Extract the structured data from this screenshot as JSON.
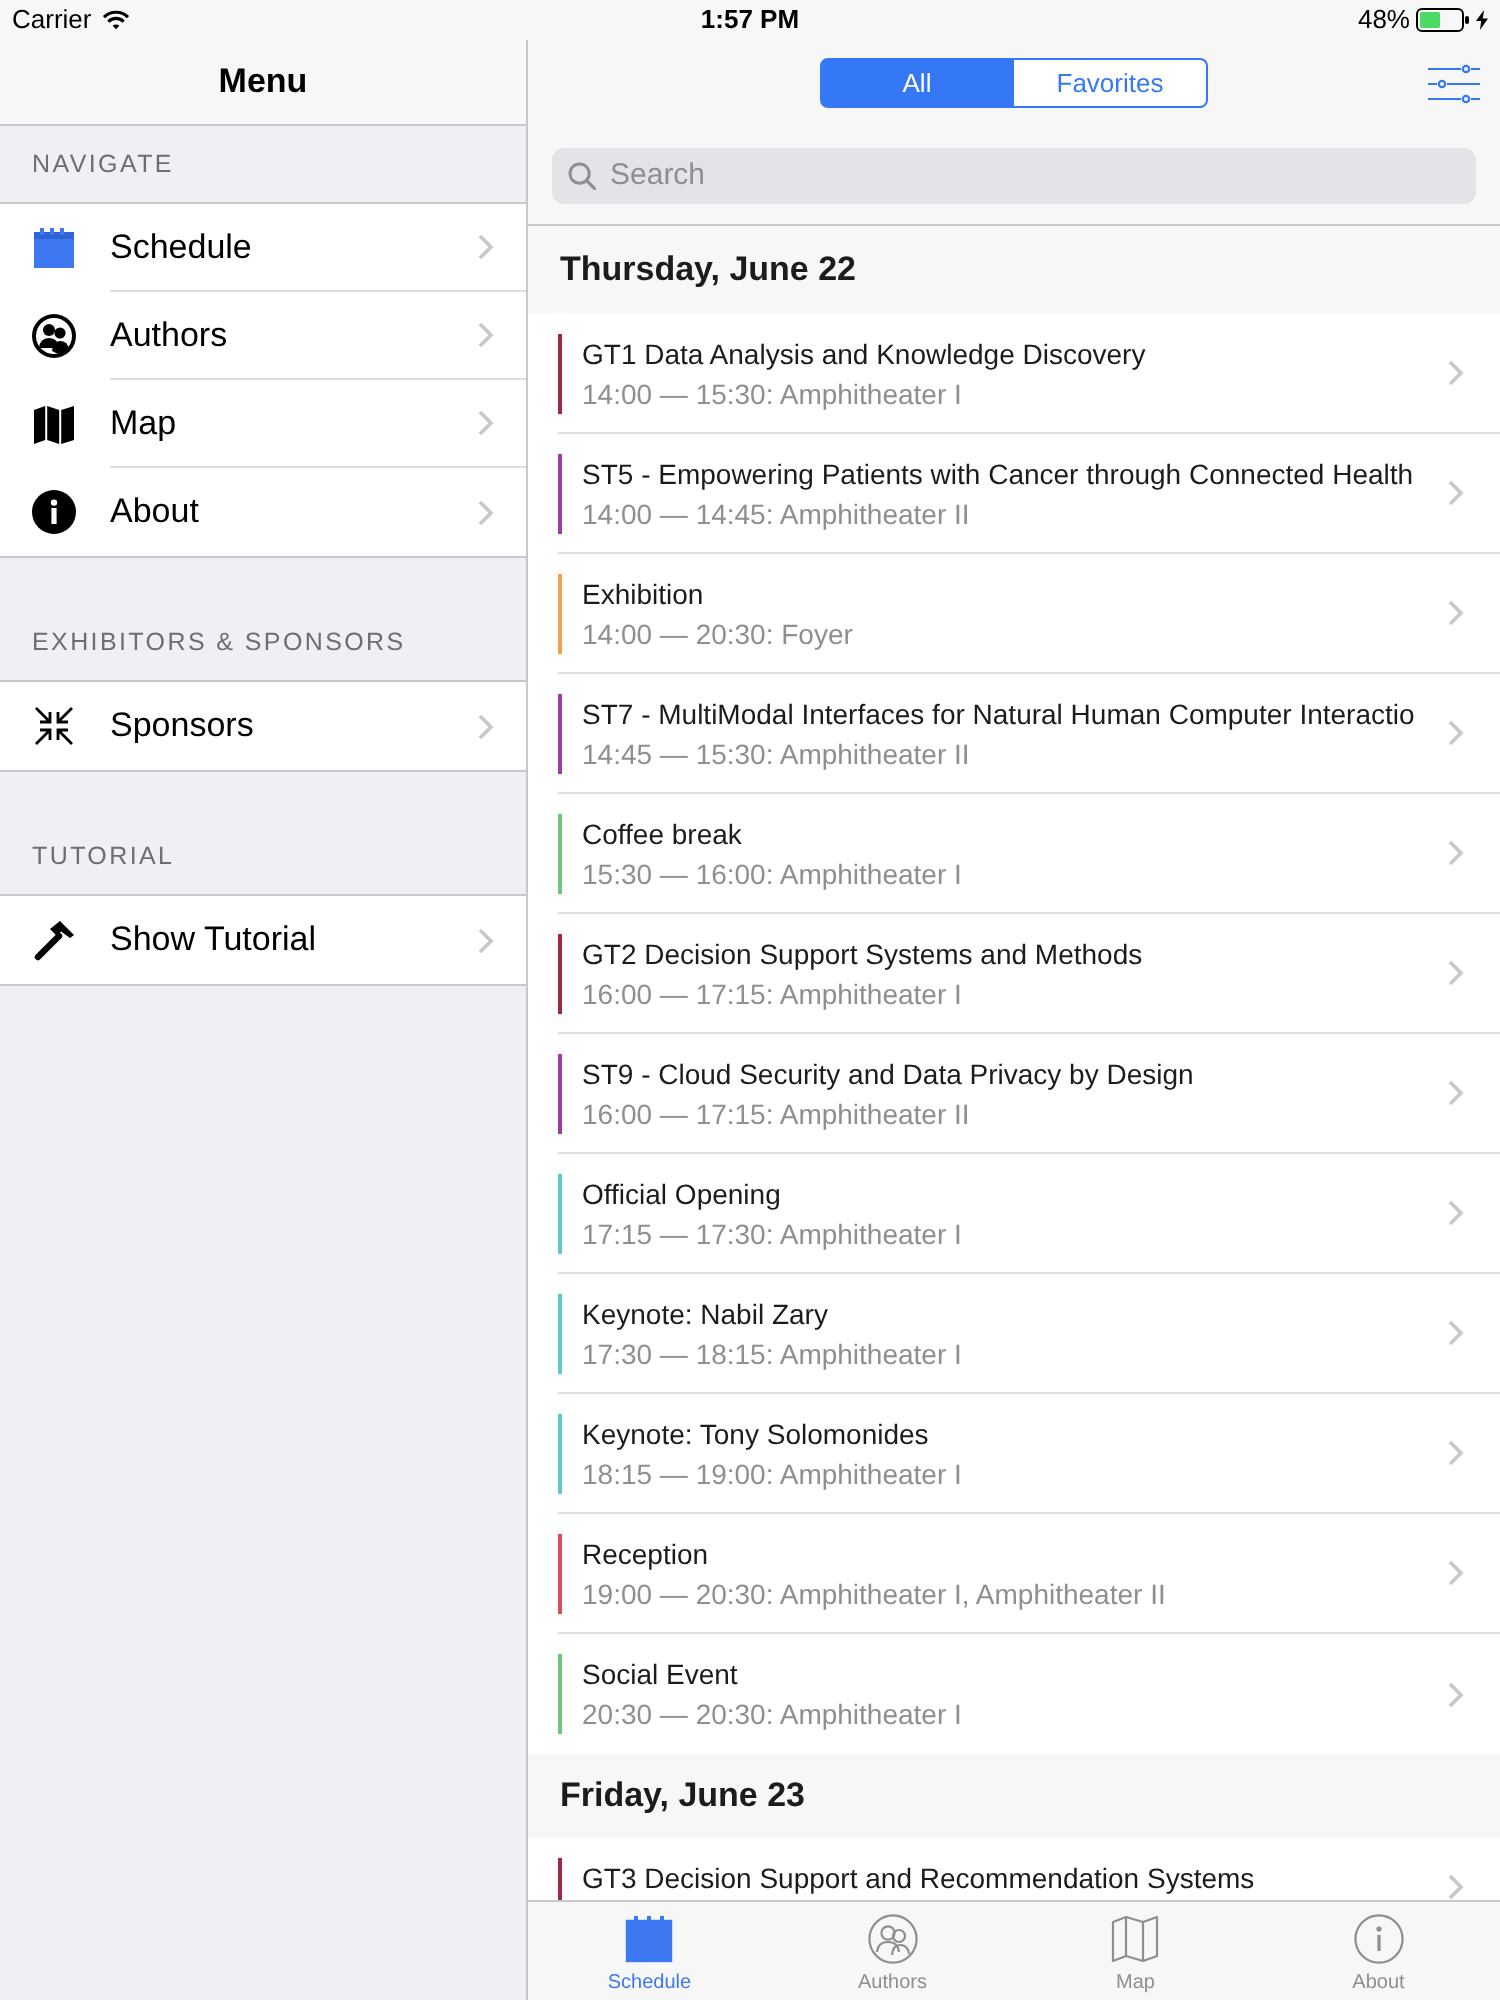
{
  "status_bar": {
    "carrier": "Carrier",
    "time": "1:57 PM",
    "battery": "48%"
  },
  "menu": {
    "title": "Menu",
    "sections": [
      {
        "header": "NAVIGATE",
        "items": [
          {
            "label": "Schedule"
          },
          {
            "label": "Authors"
          },
          {
            "label": "Map"
          },
          {
            "label": "About"
          }
        ]
      },
      {
        "header": "EXHIBITORS & SPONSORS",
        "items": [
          {
            "label": "Sponsors"
          }
        ]
      },
      {
        "header": "TUTORIAL",
        "items": [
          {
            "label": "Show Tutorial"
          }
        ]
      }
    ]
  },
  "segmented_control": [
    {
      "label": "All",
      "selected": true
    },
    {
      "label": "Favorites",
      "selected": false
    }
  ],
  "search": {
    "placeholder": "Search"
  },
  "schedule": [
    {
      "heading": "Thursday, June 22",
      "sessions": [
        {
          "title": "GT1 Data Analysis and Knowledge Discovery",
          "time": "14:00 — 15:30: Amphitheater I",
          "color": "#a3283f"
        },
        {
          "title": "ST5 - Empowering Patients with Cancer through Connected Health",
          "time": "14:00 — 14:45: Amphitheater II",
          "color": "#9b3fa0"
        },
        {
          "title": "Exhibition",
          "time": "14:00 — 20:30: Foyer",
          "color": "#eea445"
        },
        {
          "title": "ST7 - MultiModal Interfaces for Natural Human Computer Interactio",
          "time": "14:45 — 15:30: Amphitheater II",
          "color": "#9b3fa0"
        },
        {
          "title": "Coffee break",
          "time": "15:30 — 16:00: Amphitheater I",
          "color": "#74c47b"
        },
        {
          "title": "GT2 Decision Support Systems and Methods",
          "time": "16:00 — 17:15: Amphitheater I",
          "color": "#a3283f"
        },
        {
          "title": "ST9 - Cloud Security and Data Privacy by Design",
          "time": "16:00 — 17:15: Amphitheater II",
          "color": "#9b3fa0"
        },
        {
          "title": "Official Opening",
          "time": "17:15 — 17:30: Amphitheater I",
          "color": "#5fc9c3"
        },
        {
          "title": "Keynote: Nabil Zary",
          "time": "17:30 — 18:15: Amphitheater I",
          "color": "#5fc9c3"
        },
        {
          "title": "Keynote: Tony Solomonides",
          "time": "18:15 — 19:00: Amphitheater I",
          "color": "#5fc9c3"
        },
        {
          "title": "Reception",
          "time": "19:00 — 20:30: Amphitheater I, Amphitheater II",
          "color": "#e04a5c"
        },
        {
          "title": "Social Event",
          "time": "20:30 — 20:30: Amphitheater I",
          "color": "#74c47b"
        }
      ]
    },
    {
      "heading": "Friday, June 23",
      "sessions": [
        {
          "title": "GT3 Decision Support and Recommendation Systems",
          "color": "#a3283f"
        }
      ]
    }
  ],
  "tab_bar": [
    {
      "label": "Schedule",
      "selected": true
    },
    {
      "label": "Authors",
      "selected": false
    },
    {
      "label": "Map",
      "selected": false
    },
    {
      "label": "About",
      "selected": false
    }
  ]
}
